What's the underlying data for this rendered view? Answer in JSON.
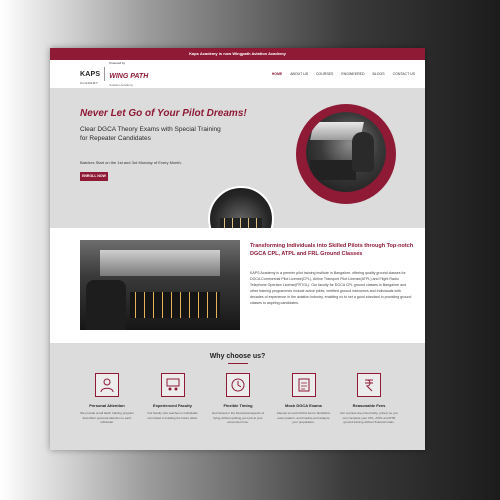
{
  "announcement": "Kaps Academy is now Wingpath Aviation Academy",
  "logo": {
    "kaps": "KAPS",
    "kaps_sub": "ACADEMY",
    "powered_by": "Powered by",
    "wingpath": "WING PATH",
    "wingpath_sub": "Aviation Academy"
  },
  "nav": {
    "items": [
      "HOME",
      "ABOUT US",
      "COURSES",
      "ENGINEERED",
      "BLOGS",
      "CONTACT US"
    ]
  },
  "hero": {
    "title": "Never Let Go of Your Pilot Dreams!",
    "subtitle": "Clear DGCA Theory Exams with Special Training for Repeater Candidates",
    "note": "Batches Start on the 1st and 3rd Monday of Every Month.",
    "enroll_label": "ENROLL NOW"
  },
  "about": {
    "heading": "Transforming Individuals into Skilled Pilots through Top-notch DGCA CPL, ATPL and FRL Ground Classes",
    "text": "KAPS Academy is a premier pilot training institute in Bangalore, offering quality ground classes for DGCA Commercial Pilot License(CPL), Airline Transport Pilot License(ATPL) and Flight Radio Telephone Operator License(FRTOL). Our faculty for DGCA CPL ground classes in Bangalore and other training programmes include active pilots, certified ground instructors and individuals with decades of experience in the aviation industry, enabling us to set a good standard in providing ground classes to aspiring candidates."
  },
  "why": {
    "title": "Why choose us?",
    "features": [
      {
        "icon": "personal-attention-icon",
        "title": "Personal Attention",
        "text": "We provide small batch training program that offers personal attention to each individual."
      },
      {
        "icon": "experienced-faculty-icon",
        "title": "Experienced Faculty",
        "text": "Our faculty who teaches in individuals committed to building the future pilots."
      },
      {
        "icon": "flexible-timing-icon",
        "title": "Flexible Timing",
        "text": "Get trained in the theoretical aspects of flying without quitting your job at your convenient time."
      },
      {
        "icon": "mock-exams-icon",
        "title": "Mock DGCA Exams",
        "text": "Attempt a mock DGCA test to familiarize exam pattern, and timeline and analyze your preparation."
      },
      {
        "icon": "reasonable-fees-icon",
        "title": "Reasonable Fees",
        "text": "Our courses are priced fairly, priced, so you can complete your CPL, ATPL and RTR ground training without financial strain."
      }
    ]
  },
  "colors": {
    "brand": "#8e1a35",
    "light_gray": "#dcdcdc"
  }
}
